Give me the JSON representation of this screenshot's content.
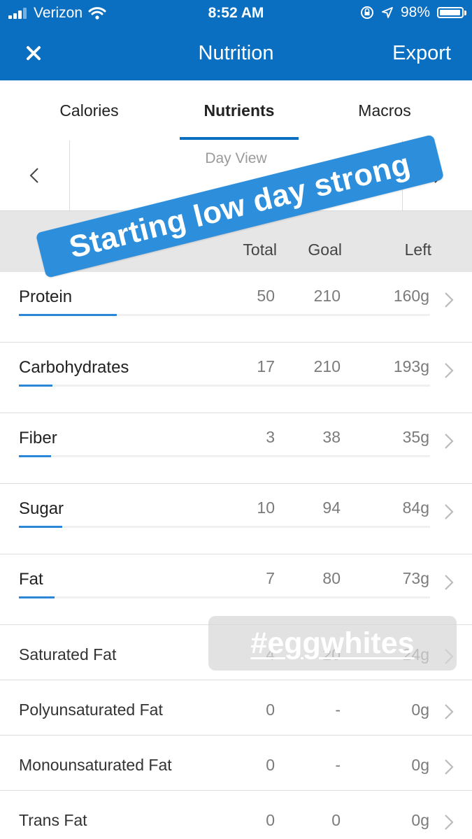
{
  "status_bar": {
    "carrier": "Verizon",
    "time": "8:52 AM",
    "battery": "98%"
  },
  "nav": {
    "close_icon": "close-icon",
    "title": "Nutrition",
    "export_label": "Export"
  },
  "tabs": [
    {
      "label": "Calories"
    },
    {
      "label": "Nutrients",
      "selected": true
    },
    {
      "label": "Macros"
    }
  ],
  "day_selector": {
    "label": "Day View"
  },
  "table_header": {
    "total": "Total",
    "goal": "Goal",
    "left": "Left"
  },
  "nutrients": [
    {
      "name": "Protein",
      "total": "50",
      "goal": "210",
      "left": "160g",
      "progress": 0.238
    },
    {
      "name": "Carbohydrates",
      "total": "17",
      "goal": "210",
      "left": "193g",
      "progress": 0.081
    },
    {
      "name": "Fiber",
      "total": "3",
      "goal": "38",
      "left": "35g",
      "progress": 0.079
    },
    {
      "name": "Sugar",
      "total": "10",
      "goal": "94",
      "left": "84g",
      "progress": 0.106
    },
    {
      "name": "Fat",
      "total": "7",
      "goal": "80",
      "left": "73g",
      "progress": 0.0875
    },
    {
      "name": "Saturated Fat",
      "total": "4",
      "goal": "20",
      "left": "24g"
    },
    {
      "name": "Polyunsaturated Fat",
      "total": "0",
      "goal": "-",
      "left": "0g"
    },
    {
      "name": "Monounsaturated Fat",
      "total": "0",
      "goal": "-",
      "left": "0g"
    },
    {
      "name": "Trans Fat",
      "total": "0",
      "goal": "0",
      "left": "0g"
    }
  ],
  "stickers": {
    "main_text": "Starting low day strong",
    "hashtag": "#eggwhites"
  },
  "colors": {
    "brand_blue": "#0b6fc1",
    "progress_blue": "#2a86d6",
    "sticker_blue": "#2d8fdc"
  }
}
